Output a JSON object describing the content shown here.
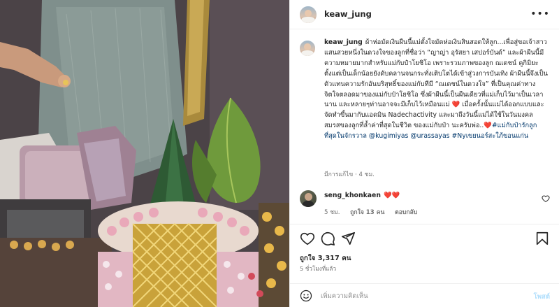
{
  "post": {
    "username": "keaw_jung",
    "more_label": "•••"
  },
  "caption": {
    "username": "keaw_jung",
    "segments": [
      {
        "text": "ผ้าห่อมัดเงินผืนนี้แม่ตั้งใจมัดห่อเงินสินสอดให้ลูก...เพื่อสู่ขอเจ้าสาวแสนสวยหนึ่งในดวงใจของลูกที่ชื่อว่า “ญาญ่า อุรัสยา เสปอร์บันด์” และผ้าผืนนี้มีความหมายมากสำหรับแม่กับป๋าโยชิโอ เพราะรวมภาพของลูก ณเดชน์ คูกิมิยะ ตั้งแต่เป็นเด็กน้อยยังดับคลานจนกระทั่งเติบโตได้เข้าสู่วงการบันเทิง ผ้าผืนนี้จึงเป็นตัวแทนความรักอันบริสุทธิ์ของแม่กับทีมี “ณเดชน์ในดวงใจ” ที่เป็นคุณค่าทางจิตใจตลอดมาของแม่กับป๋าโยชิโอ ซึ่งผ้าผืนนี้เป็นผืนเดียวที่แม่เก็บไว้มาเป็นเวลานาน และหลายๆท่านอาจจะมีเก็บไว้เหมือนแม่ ",
        "type": "text"
      },
      {
        "text": "❤️",
        "type": "heart"
      },
      {
        "text": " เมื่อครั้งนั้นแม่ได้ออกแบบและจัดทำขึ้นมากับแอดมิน Nadechactivity และมาถึงวันนี้แม่ได้ใช้ในวันมงคลสมรสของลูกที่ล้ำค่าที่สุดในชีวิต ของแม่กับป๋า นะครับพ่อ..",
        "type": "text"
      },
      {
        "text": "❤️",
        "type": "heart"
      },
      {
        "text": "#แม่กับป๋ารักลูกที่สุดในจักรวาล",
        "type": "tag"
      },
      {
        "text": " ",
        "type": "text"
      },
      {
        "text": "@kugimiyas",
        "type": "tag"
      },
      {
        "text": " ",
        "type": "text"
      },
      {
        "text": "@urassayas",
        "type": "tag"
      },
      {
        "text": " ",
        "type": "text"
      },
      {
        "text": "#Nyเขยนอร์สะใภ้ขอนแก่น",
        "type": "tag"
      }
    ],
    "meta": "มีการแก้ไข · 4 ชม."
  },
  "comment": {
    "username": "seng_khonkaen",
    "text": "❤️❤️",
    "time": "5 ชม.",
    "likes": "ถูกใจ 13 คน",
    "reply": "ตอบกลับ"
  },
  "stats": {
    "likes": "ถูกใจ 3,317 คน",
    "time_ago": "5 ชั่วโมงที่แล้ว"
  },
  "composer": {
    "placeholder": "เพิ่มความคิดเห็น",
    "post_label": "โพสต์"
  },
  "icons": [
    "heart-icon",
    "comment-icon",
    "share-icon",
    "save-icon",
    "emoji-icon",
    "more-icon"
  ],
  "colors": {
    "link": "#00376b",
    "heart": "#ed1f45",
    "muted": "#737373",
    "post_disabled": "#b2dffc"
  }
}
